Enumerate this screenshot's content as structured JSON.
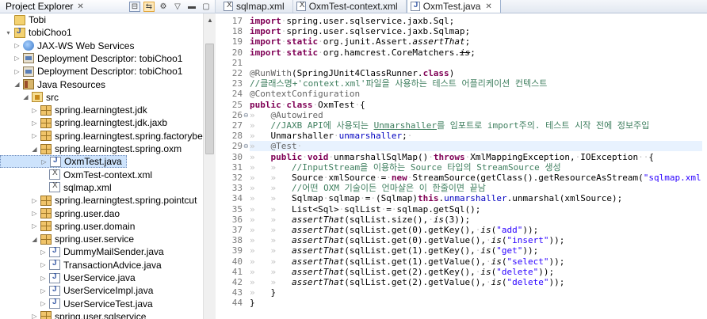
{
  "explorer": {
    "title": "Project Explorer",
    "tree": [
      {
        "label": "Tobi",
        "icon": "project-icon",
        "indent": 0,
        "arrow": ""
      },
      {
        "label": "tobiChoo1",
        "icon": "java-project-icon",
        "indent": 0,
        "arrow": "▾"
      },
      {
        "label": "JAX-WS Web Services",
        "icon": "web-services-icon",
        "indent": 1,
        "arrow": "▷"
      },
      {
        "label": "Deployment Descriptor: tobiChoo1",
        "icon": "deployment-descriptor-icon",
        "indent": 1,
        "arrow": "▷"
      },
      {
        "label": "Deployment Descriptor: tobiChoo1",
        "icon": "deployment-descriptor-icon",
        "indent": 1,
        "arrow": "▷"
      },
      {
        "label": "Java Resources",
        "icon": "java-resources-icon",
        "indent": 1,
        "arrow": "◢"
      },
      {
        "label": "src",
        "icon": "source-folder-icon",
        "indent": 2,
        "arrow": "◢"
      },
      {
        "label": "spring.learningtest.jdk",
        "icon": "package-icon",
        "indent": 3,
        "arrow": "▷"
      },
      {
        "label": "spring.learningtest.jdk.jaxb",
        "icon": "package-icon",
        "indent": 3,
        "arrow": "▷"
      },
      {
        "label": "spring.learningtest.spring.factorybean",
        "icon": "package-icon",
        "indent": 3,
        "arrow": "▷"
      },
      {
        "label": "spring.learningtest.spring.oxm",
        "icon": "package-icon",
        "indent": 3,
        "arrow": "◢"
      },
      {
        "label": "OxmTest.java",
        "icon": "java-file-icon",
        "indent": 4,
        "arrow": "▷",
        "selected": true
      },
      {
        "label": "OxmTest-context.xml",
        "icon": "xml-file-icon",
        "indent": 4,
        "arrow": ""
      },
      {
        "label": "sqlmap.xml",
        "icon": "xml-file-icon",
        "indent": 4,
        "arrow": ""
      },
      {
        "label": "spring.learningtest.spring.pointcut",
        "icon": "package-icon",
        "indent": 3,
        "arrow": "▷"
      },
      {
        "label": "spring.user.dao",
        "icon": "package-icon",
        "indent": 3,
        "arrow": "▷"
      },
      {
        "label": "spring.user.domain",
        "icon": "package-icon",
        "indent": 3,
        "arrow": "▷"
      },
      {
        "label": "spring.user.service",
        "icon": "package-icon",
        "indent": 3,
        "arrow": "◢"
      },
      {
        "label": "DummyMailSender.java",
        "icon": "java-file-icon",
        "indent": 4,
        "arrow": "▷"
      },
      {
        "label": "TransactionAdvice.java",
        "icon": "java-file-icon",
        "indent": 4,
        "arrow": "▷"
      },
      {
        "label": "UserService.java",
        "icon": "java-file-icon",
        "indent": 4,
        "arrow": "▷"
      },
      {
        "label": "UserServiceImpl.java",
        "icon": "java-file-icon",
        "indent": 4,
        "arrow": "▷"
      },
      {
        "label": "UserServiceTest.java",
        "icon": "java-file-icon",
        "indent": 4,
        "arrow": "▷"
      },
      {
        "label": "spring.user.sqlservice",
        "icon": "package-icon",
        "indent": 3,
        "arrow": "▷"
      }
    ]
  },
  "editor": {
    "tabs": [
      {
        "label": "sqlmap.xml",
        "icon": "xml-file-icon",
        "active": false
      },
      {
        "label": "OxmTest-context.xml",
        "icon": "xml-file-icon",
        "active": false
      },
      {
        "label": "OxmTest.java",
        "icon": "java-file-icon",
        "active": true
      }
    ],
    "lines": [
      {
        "n": "17",
        "fold": "",
        "html": "<span class='kw'>import</span><span class='ws'>·</span>spring.user.sqlservice.jaxb.Sql;"
      },
      {
        "n": "18",
        "fold": "",
        "html": "<span class='kw'>import</span><span class='ws'>·</span>spring.user.sqlservice.jaxb.Sqlmap;"
      },
      {
        "n": "19",
        "fold": "",
        "html": "<span class='kw'>import</span><span class='ws'>·</span><span class='kw'>static</span><span class='ws'>·</span>org.junit.Assert.<span class='sm'>assertThat</span>;"
      },
      {
        "n": "20",
        "fold": "",
        "html": "<span class='kw'>import</span><span class='ws'>·</span><span class='kw'>static</span><span class='ws'>·</span>org.hamcrest.CoreMatchers.<span class='sm' style='text-decoration:line-through'>is</span>;"
      },
      {
        "n": "21",
        "fold": "",
        "html": ""
      },
      {
        "n": "22",
        "fold": "",
        "html": "<span class='an'>@RunWith</span>(SpringJUnit4ClassRunner.<span class='kw'>class</span>)"
      },
      {
        "n": "23",
        "fold": "",
        "html": "<span class='cm'>//클래스명+'context.xml'파일을 사용하는 테스트 어플리케이션 컨텍스트</span>"
      },
      {
        "n": "24",
        "fold": "",
        "html": "<span class='an'>@ContextConfiguration</span>"
      },
      {
        "n": "25",
        "fold": "",
        "html": "<span class='kw'>public</span><span class='ws'>·</span><span class='kw'>class</span><span class='ws'>·</span>OxmTest<span class='ws'>·</span>{"
      },
      {
        "n": "26",
        "fold": "⊖",
        "html": "<span class='ws'>»   </span><span class='an'>@Autowired</span>"
      },
      {
        "n": "27",
        "fold": "",
        "html": "<span class='ws'>»   </span><span class='cm'>//JAXB API에 사용되는 <u>Unmarshaller</u>를 임포트로 import주의. 테스트 시작 전에 정보주입</span>"
      },
      {
        "n": "28",
        "fold": "",
        "html": "<span class='ws'>»   </span>Unmarshaller<span class='ws'>·</span><span class='fd'>unmarshaller</span>;<span class='ws'>·</span>"
      },
      {
        "n": "29",
        "fold": "⊖",
        "html": "<span class='ws'>»   </span><span class='an'>@Test</span><span class='ws'>·</span>",
        "current": true
      },
      {
        "n": "30",
        "fold": "",
        "html": "<span class='ws'>»   </span><span class='kw'>public</span><span class='ws'>·</span><span class='kw'>void</span><span class='ws'>·</span>unmarshallSqlMap()<span class='ws'>·</span><span class='kw'>throws</span><span class='ws'>·</span>XmlMappingException,<span class='ws'>·</span>IOException<span class='ws'>··</span>{"
      },
      {
        "n": "31",
        "fold": "",
        "html": "<span class='ws'>»   »   </span><span class='cm'>//InputStream을 이용하는 Source 타입의 StreamSource 생성</span>"
      },
      {
        "n": "32",
        "fold": "",
        "html": "<span class='ws'>»   »   </span>Source<span class='ws'>·</span>xmlSource<span class='ws'>·</span>=<span class='ws'>·</span><span class='kw'>new</span><span class='ws'>·</span>StreamSource(getClass().getResourceAsStream(<span class='st'>\"sqlmap.xml\"</span>));"
      },
      {
        "n": "33",
        "fold": "",
        "html": "<span class='ws'>»   »   </span><span class='cm'>//어떤 OXM 기술이든 언마샬은 이 한줄이면 끝남</span>"
      },
      {
        "n": "34",
        "fold": "",
        "html": "<span class='ws'>»   »   </span>Sqlmap<span class='ws'>·</span>sqlmap<span class='ws'>·</span>=<span class='ws'>·</span>(Sqlmap)<span class='kw'>this</span>.<span class='fd'>unmarshaller</span>.unmarshal(xmlSource);"
      },
      {
        "n": "35",
        "fold": "",
        "html": "<span class='ws'>»   »   </span>List&lt;Sql&gt;<span class='ws'>·</span>sqlList<span class='ws'>·</span>=<span class='ws'>·</span>sqlmap.getSql();"
      },
      {
        "n": "36",
        "fold": "",
        "html": "<span class='ws'>»   »   </span><span class='sm'>assertThat</span>(sqlList.size(),<span class='ws'>·</span><span class='sm'>is</span>(3));"
      },
      {
        "n": "37",
        "fold": "",
        "html": "<span class='ws'>»   »   </span><span class='sm'>assertThat</span>(sqlList.get(0).getKey(),<span class='ws'>·</span><span class='sm'>is</span>(<span class='st'>\"add\"</span>));"
      },
      {
        "n": "38",
        "fold": "",
        "html": "<span class='ws'>»   »   </span><span class='sm'>assertThat</span>(sqlList.get(0).getValue(),<span class='ws'>·</span><span class='sm'>is</span>(<span class='st'>\"insert\"</span>));"
      },
      {
        "n": "39",
        "fold": "",
        "html": "<span class='ws'>»   »   </span><span class='sm'>assertThat</span>(sqlList.get(1).getKey(),<span class='ws'>·</span><span class='sm'>is</span>(<span class='st'>\"get\"</span>));"
      },
      {
        "n": "40",
        "fold": "",
        "html": "<span class='ws'>»   »   </span><span class='sm'>assertThat</span>(sqlList.get(1).getValue(),<span class='ws'>·</span><span class='sm'>is</span>(<span class='st'>\"select\"</span>));"
      },
      {
        "n": "41",
        "fold": "",
        "html": "<span class='ws'>»   »   </span><span class='sm'>assertThat</span>(sqlList.get(2).getKey(),<span class='ws'>·</span><span class='sm'>is</span>(<span class='st'>\"delete\"</span>));"
      },
      {
        "n": "42",
        "fold": "",
        "html": "<span class='ws'>»   »   </span><span class='sm'>assertThat</span>(sqlList.get(2).getValue(),<span class='ws'>·</span><span class='sm'>is</span>(<span class='st'>\"delete\"</span>));"
      },
      {
        "n": "43",
        "fold": "",
        "html": "<span class='ws'>»   </span>}"
      },
      {
        "n": "44",
        "fold": "",
        "html": "}"
      }
    ]
  }
}
